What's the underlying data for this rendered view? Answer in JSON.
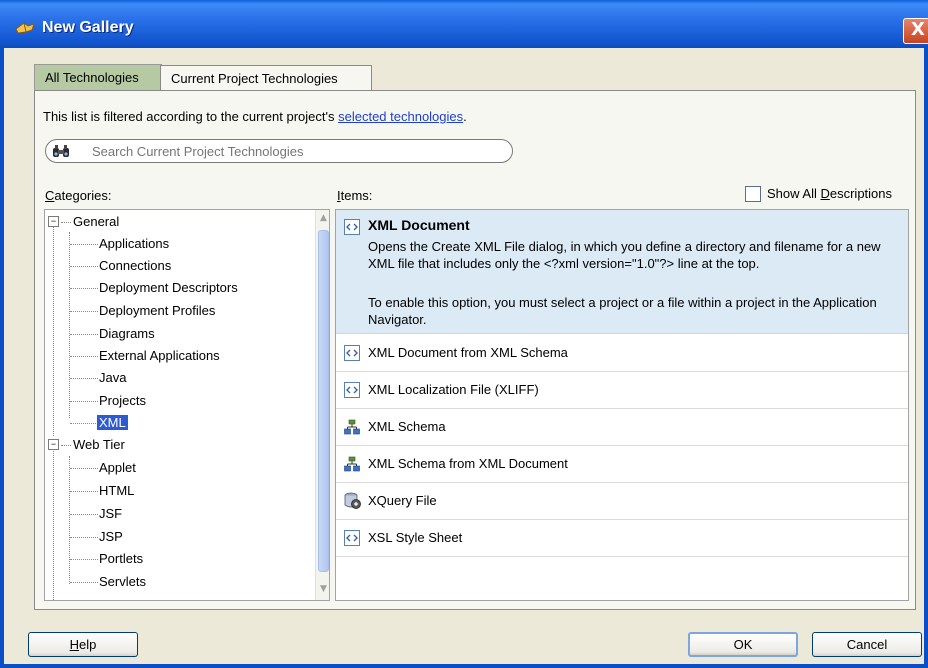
{
  "window": {
    "title": "New Gallery",
    "close_label": "X"
  },
  "tabs": [
    {
      "label": "All Technologies"
    },
    {
      "label": "Current Project Technologies"
    }
  ],
  "filter": {
    "text_prefix": "This list is filtered according to the current project's ",
    "link_text": "selected technologies",
    "text_suffix": "."
  },
  "search": {
    "placeholder": "Search Current Project Technologies"
  },
  "categories": {
    "label_first": "C",
    "label_rest": "ategories:",
    "groups": [
      {
        "label": "General",
        "expander": "−",
        "children": [
          "Applications",
          "Connections",
          "Deployment Descriptors",
          "Deployment Profiles",
          "Diagrams",
          "External Applications",
          "Java",
          "Projects",
          "XML"
        ]
      },
      {
        "label": "Web Tier",
        "expander": "−",
        "children": [
          "Applet",
          "HTML",
          "JSF",
          "JSP",
          "Portlets",
          "Servlets"
        ]
      }
    ],
    "selected": "XML"
  },
  "items_panel": {
    "label_first": "I",
    "label_rest": "tems:",
    "show_all_prefix": "Show All ",
    "show_all_underlined": "D",
    "show_all_suffix": "escriptions",
    "show_all_checked": false
  },
  "items": [
    {
      "title": "XML Document",
      "icon": "xml-file-icon",
      "desc1": "Opens the Create XML File dialog, in which you define a directory and filename for a new XML file that includes only the <?xml version=\"1.0\"?> line at the top.",
      "desc2": "To enable this option, you must select a project or a file within a project in the Application Navigator."
    },
    {
      "title": "XML Document from XML Schema",
      "icon": "xml-file-icon"
    },
    {
      "title": "XML Localization File (XLIFF)",
      "icon": "xml-file-icon"
    },
    {
      "title": "XML Schema",
      "icon": "schema-icon"
    },
    {
      "title": "XML Schema from XML Document",
      "icon": "schema-icon"
    },
    {
      "title": "XQuery File",
      "icon": "xquery-icon"
    },
    {
      "title": "XSL Style Sheet",
      "icon": "xml-file-icon"
    }
  ],
  "buttons": {
    "help_underlined": "H",
    "help_rest": "elp",
    "ok": "OK",
    "cancel": "Cancel"
  },
  "colors": {
    "titlebar": "#1257D0",
    "selection": "#2D5BD0",
    "item_highlight": "#DCEAF6",
    "link": "#1E3FD0"
  }
}
